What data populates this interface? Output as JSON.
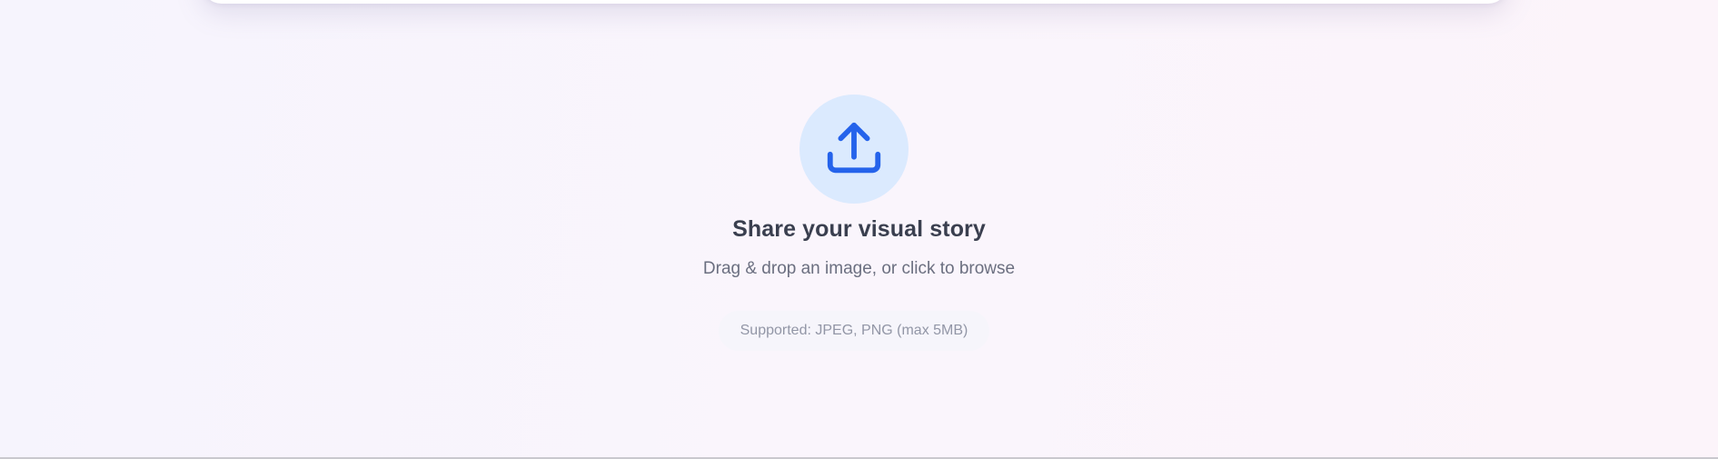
{
  "upload": {
    "icon": "upload-icon",
    "title": "Share your visual story",
    "subtitle": "Drag & drop an image, or click to browse",
    "supported": "Supported: JPEG, PNG (max 5MB)"
  },
  "colors": {
    "accent": "#2563eb",
    "icon_bg": "#dbeafe",
    "title": "#3a3f4f",
    "subtitle": "#6b6f80",
    "muted": "#9296a6"
  }
}
